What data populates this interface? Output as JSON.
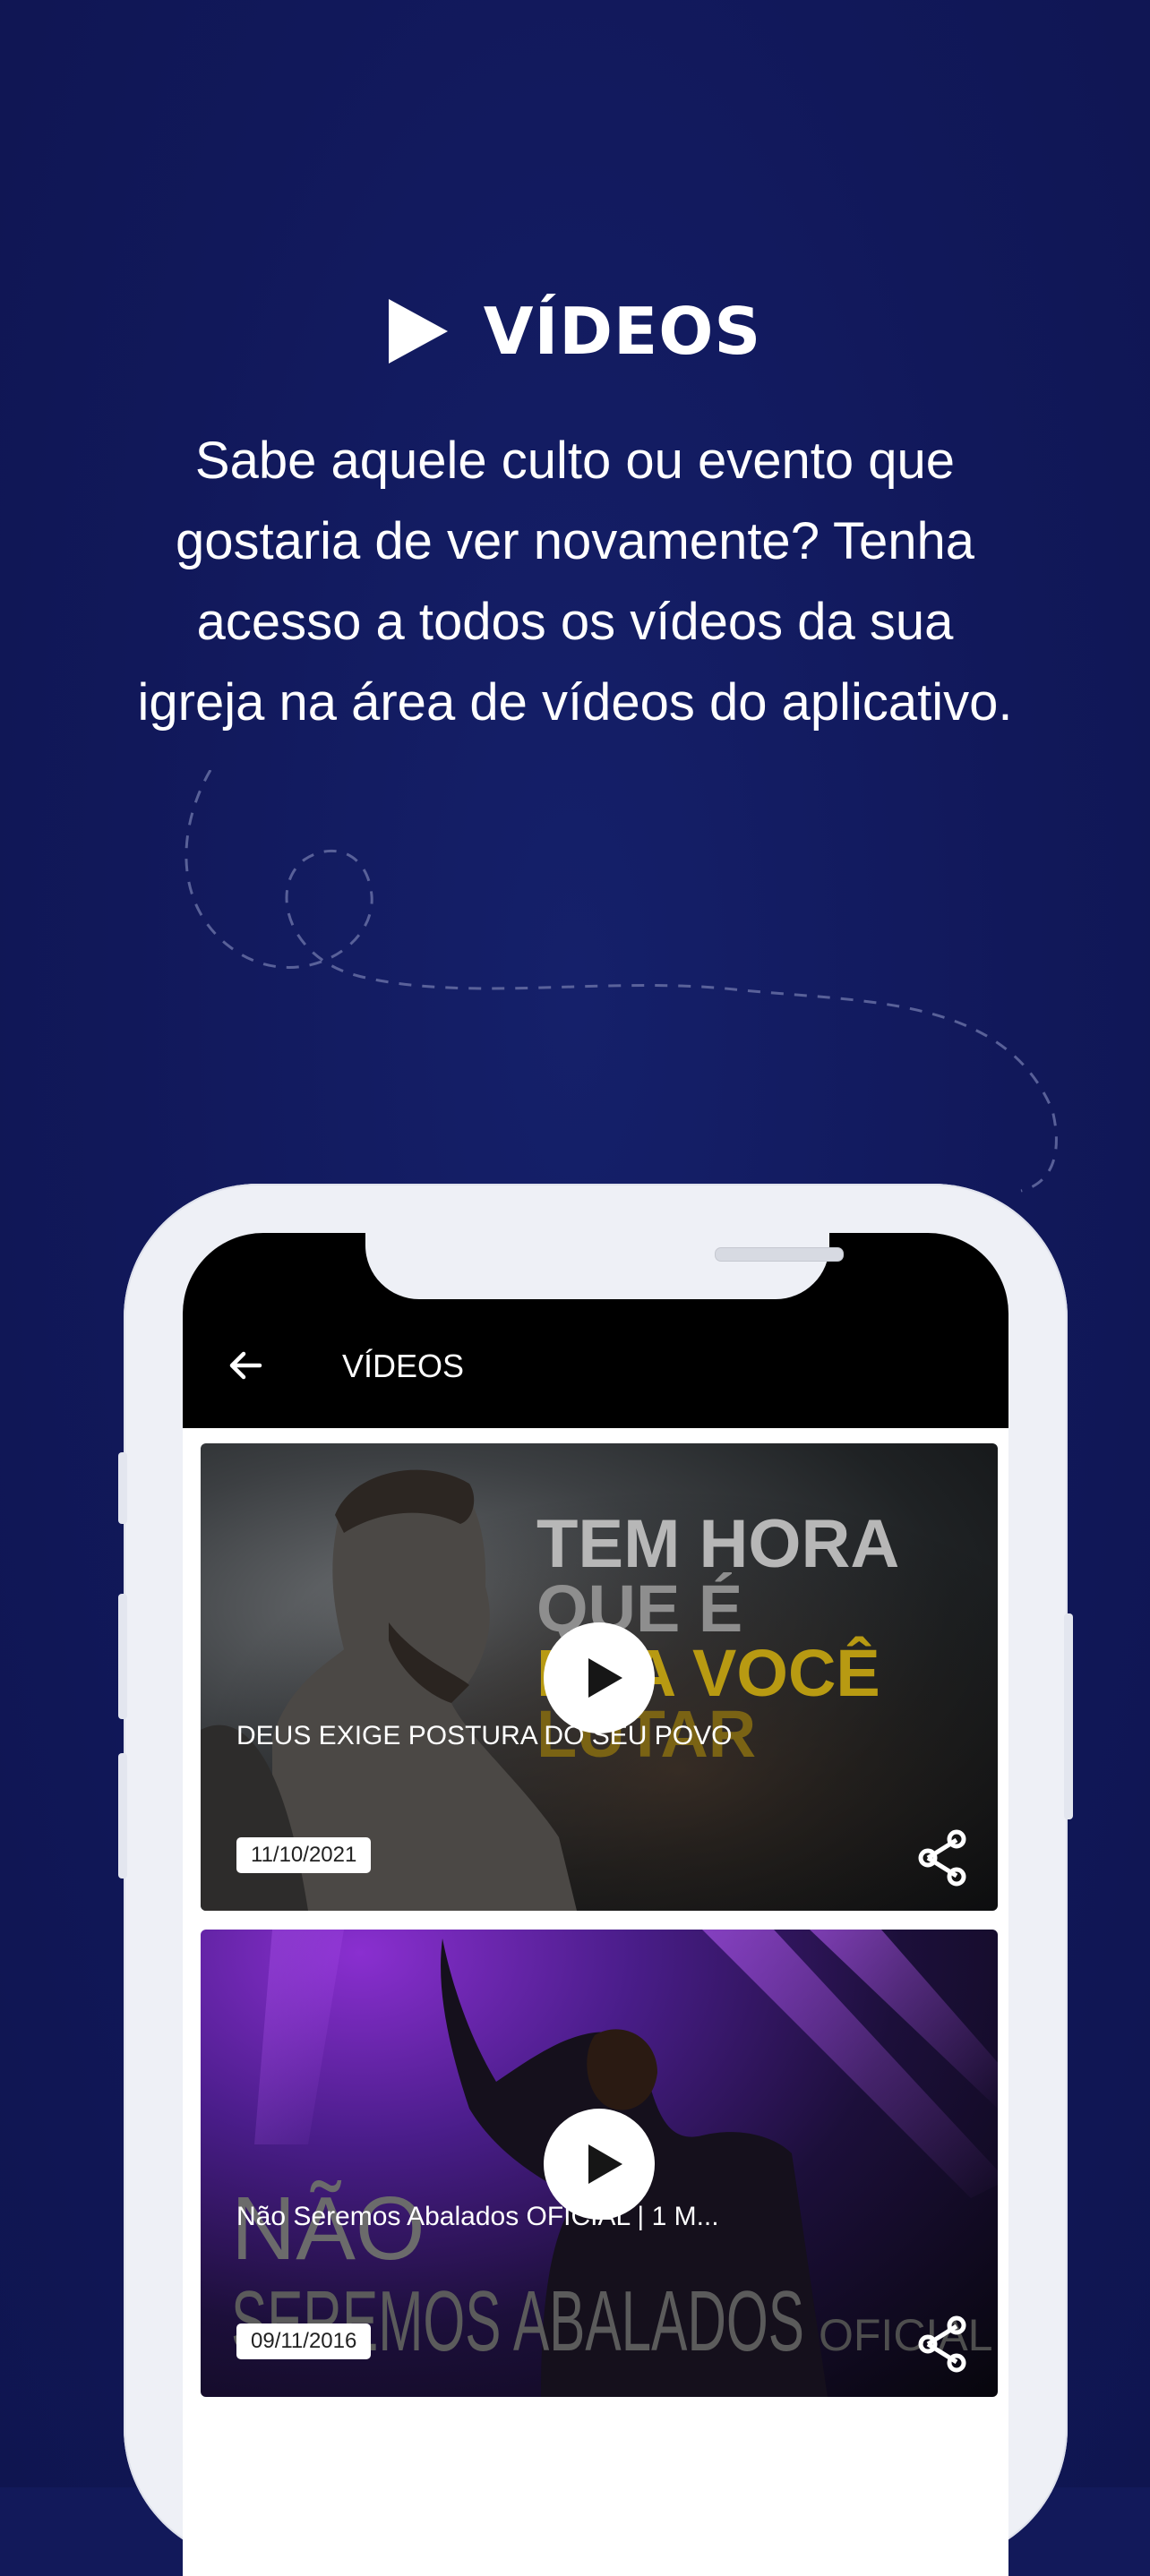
{
  "promo": {
    "title": "VÍDEOS",
    "description": "Sabe aquele culto ou evento que gostaria de ver novamente? Tenha acesso a todos os vídeos da sua igreja na área de vídeos do aplicativo."
  },
  "app": {
    "back_icon": "arrow-left-icon",
    "title": "VÍDEOS"
  },
  "videos": [
    {
      "title": "DEUS EXIGE POSTURA DO SEU POVO",
      "date": "11/10/2021",
      "thumbnail_text": [
        "TEM HORA",
        "QUE É",
        "PRA VOCÊ",
        "LUTAR"
      ]
    },
    {
      "title": "Não Seremos Abalados OFICIAL | 1 M...",
      "date": "09/11/2016",
      "thumbnail_text": [
        "NÃO",
        "SEREMOS ABALADOS",
        "OFICIAL"
      ]
    }
  ],
  "colors": {
    "background": "#12195a",
    "accent_yellow": "#b89a12",
    "app_bar": "#000000"
  }
}
